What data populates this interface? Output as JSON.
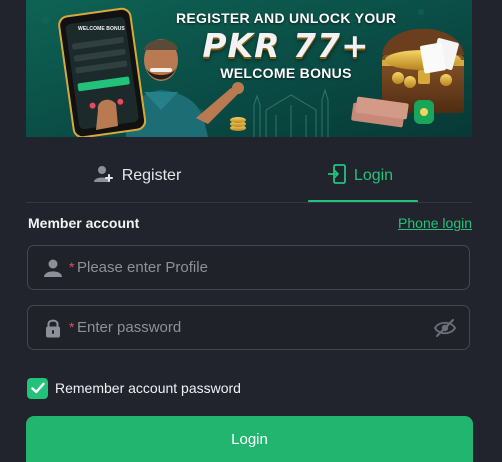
{
  "banner": {
    "headline": "REGISTER AND UNLOCK YOUR",
    "amount": "PKR 77+",
    "subtitle": "WELCOME BONUS",
    "phone_screen_title": "WELCOME BONUS",
    "colors": {
      "background": "#0b4f47",
      "gold": "#e2b23a"
    }
  },
  "tabs": {
    "register": {
      "label": "Register",
      "icon": "user-plus-icon"
    },
    "login": {
      "label": "Login",
      "icon": "login-door-icon",
      "active": true
    }
  },
  "form": {
    "section_label": "Member account",
    "phone_login_link": "Phone login",
    "account_field": {
      "icon": "user-icon",
      "required_marker": "*",
      "placeholder": "Please enter Profile",
      "value": ""
    },
    "password_field": {
      "icon": "lock-icon",
      "required_marker": "*",
      "placeholder": "Enter password",
      "value": "",
      "toggle_icon": "eye-off-icon"
    },
    "remember": {
      "label": "Remember account password",
      "checked": true
    },
    "submit_label": "Login"
  },
  "colors": {
    "accent": "#22c27a",
    "background": "#22242d",
    "field_border": "#44474f",
    "required": "#e84a57"
  }
}
